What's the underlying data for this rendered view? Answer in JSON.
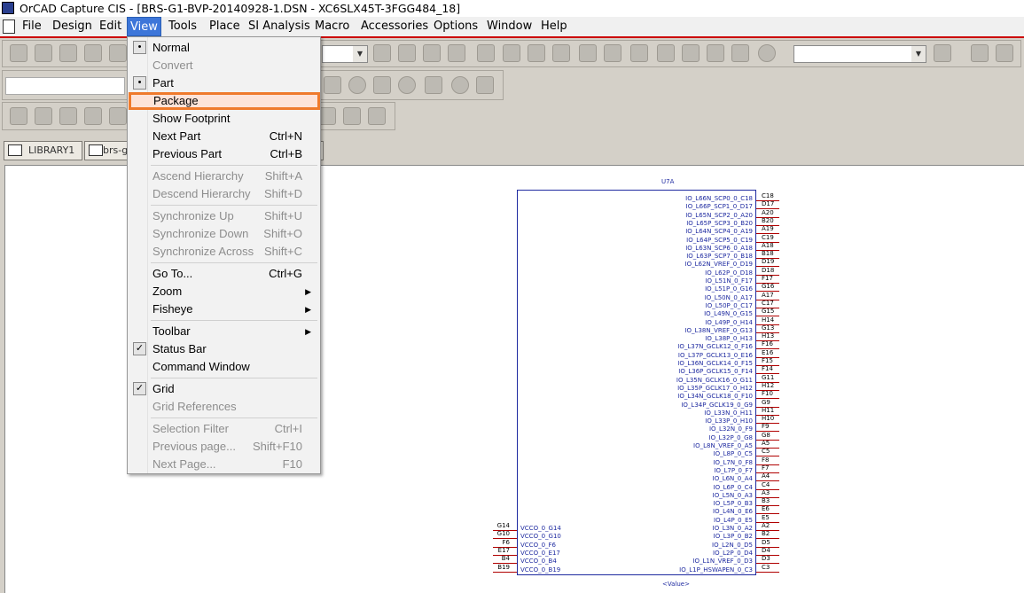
{
  "window": {
    "title": "OrCAD Capture CIS - [BRS-G1-BVP-20140928-1.DSN - XC6SLX45T-3FGG484_18]"
  },
  "menubar": [
    "File",
    "Design",
    "Edit",
    "View",
    "Tools",
    "Place",
    "SI Analysis",
    "Macro",
    "Accessories",
    "Options",
    "Window",
    "Help"
  ],
  "tabs": [
    "LIBRARY1",
    "brs-g"
  ],
  "view_menu": [
    {
      "label": "Normal",
      "bullet": true
    },
    {
      "label": "Convert",
      "disabled": true
    },
    {
      "label": "Part",
      "bullet": true
    },
    {
      "label": "Package",
      "highlight": true
    },
    {
      "label": "Show Footprint"
    },
    {
      "label": "Next Part",
      "shortcut": "Ctrl+N"
    },
    {
      "label": "Previous Part",
      "shortcut": "Ctrl+B"
    },
    {
      "sep": true
    },
    {
      "label": "Ascend Hierarchy",
      "shortcut": "Shift+A",
      "disabled": true
    },
    {
      "label": "Descend Hierarchy",
      "shortcut": "Shift+D",
      "disabled": true
    },
    {
      "sep": true
    },
    {
      "label": "Synchronize Up",
      "shortcut": "Shift+U",
      "disabled": true
    },
    {
      "label": "Synchronize Down",
      "shortcut": "Shift+O",
      "disabled": true
    },
    {
      "label": "Synchronize Across",
      "shortcut": "Shift+C",
      "disabled": true
    },
    {
      "sep": true
    },
    {
      "label": "Go To...",
      "shortcut": "Ctrl+G"
    },
    {
      "label": "Zoom",
      "submenu": true
    },
    {
      "label": "Fisheye",
      "submenu": true
    },
    {
      "sep": true
    },
    {
      "label": "Toolbar",
      "submenu": true
    },
    {
      "label": "Status Bar",
      "check": true
    },
    {
      "label": "Command Window"
    },
    {
      "sep": true
    },
    {
      "label": "Grid",
      "check": true
    },
    {
      "label": "Grid References",
      "disabled": true
    },
    {
      "sep": true
    },
    {
      "label": "Selection Filter",
      "shortcut": "Ctrl+I",
      "disabled": true
    },
    {
      "label": "Previous page...",
      "shortcut": "Shift+F10",
      "disabled": true
    },
    {
      "label": "Next Page...",
      "shortcut": "F10",
      "disabled": true
    }
  ],
  "part": {
    "refdes": "U7A",
    "value": "<Value>"
  },
  "right_pins": [
    [
      "IO_L66N_SCP0_0_C18",
      "C18"
    ],
    [
      "IO_L66P_SCP1_0_D17",
      "D17"
    ],
    [
      "IO_L65N_SCP2_0_A20",
      "A20"
    ],
    [
      "IO_L65P_SCP3_0_B20",
      "B20"
    ],
    [
      "IO_L64N_SCP4_0_A19",
      "A19"
    ],
    [
      "IO_L64P_SCP5_0_C19",
      "C19"
    ],
    [
      "IO_L63N_SCP6_0_A18",
      "A18"
    ],
    [
      "IO_L63P_SCP7_0_B18",
      "B18"
    ],
    [
      "IO_L62N_VREF_0_D19",
      "D19"
    ],
    [
      "IO_L62P_0_D18",
      "D18"
    ],
    [
      "IO_L51N_0_F17",
      "F17"
    ],
    [
      "IO_L51P_0_G16",
      "G16"
    ],
    [
      "IO_L50N_0_A17",
      "A17"
    ],
    [
      "IO_L50P_0_C17",
      "C17"
    ],
    [
      "IO_L49N_0_G15",
      "G15"
    ],
    [
      "IO_L49P_0_H14",
      "H14"
    ],
    [
      "IO_L38N_VREF_0_G13",
      "G13"
    ],
    [
      "IO_L38P_0_H13",
      "H13"
    ],
    [
      "IO_L37N_GCLK12_0_F16",
      "F16"
    ],
    [
      "IO_L37P_GCLK13_0_E16",
      "E16"
    ],
    [
      "IO_L36N_GCLK14_0_F15",
      "F15"
    ],
    [
      "IO_L36P_GCLK15_0_F14",
      "F14"
    ],
    [
      "IO_L35N_GCLK16_0_G11",
      "G11"
    ],
    [
      "IO_L35P_GCLK17_0_H12",
      "H12"
    ],
    [
      "IO_L34N_GCLK18_0_F10",
      "F10"
    ],
    [
      "IO_L34P_GCLK19_0_G9",
      "G9"
    ],
    [
      "IO_L33N_0_H11",
      "H11"
    ],
    [
      "IO_L33P_0_H10",
      "H10"
    ],
    [
      "IO_L32N_0_F9",
      "F9"
    ],
    [
      "IO_L32P_0_G8",
      "G8"
    ],
    [
      "IO_L8N_VREF_0_A5",
      "A5"
    ],
    [
      "IO_L8P_0_C5",
      "C5"
    ],
    [
      "IO_L7N_0_F8",
      "F8"
    ],
    [
      "IO_L7P_0_F7",
      "F7"
    ],
    [
      "IO_L6N_0_A4",
      "A4"
    ],
    [
      "IO_L6P_0_C4",
      "C4"
    ],
    [
      "IO_L5N_0_A3",
      "A3"
    ],
    [
      "IO_L5P_0_B3",
      "B3"
    ],
    [
      "IO_L4N_0_E6",
      "E6"
    ],
    [
      "IO_L4P_0_E5",
      "E5"
    ],
    [
      "IO_L3N_0_A2",
      "A2"
    ],
    [
      "IO_L3P_0_B2",
      "B2"
    ],
    [
      "IO_L2N_0_D5",
      "D5"
    ],
    [
      "IO_L2P_0_D4",
      "D4"
    ],
    [
      "IO_L1N_VREF_0_D3",
      "D3"
    ],
    [
      "IO_L1P_HSWAPEN_0_C3",
      "C3"
    ]
  ],
  "left_pins": [
    [
      "G14",
      "VCCO_0_G14"
    ],
    [
      "G10",
      "VCCO_0_G10"
    ],
    [
      "F6",
      "VCCO_0_F6"
    ],
    [
      "E17",
      "VCCO_0_E17"
    ],
    [
      "B4",
      "VCCO_0_B4"
    ],
    [
      "B19",
      "VCCO_0_B19"
    ]
  ]
}
